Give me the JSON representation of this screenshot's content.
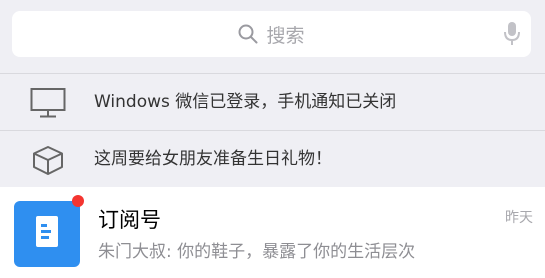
{
  "search": {
    "placeholder_text": "搜索",
    "icon": "search-icon",
    "mic_icon": "microphone-icon"
  },
  "notices": [
    {
      "icon": "monitor-icon",
      "text": "Windows 微信已登录，手机通知已关闭"
    },
    {
      "icon": "box-icon",
      "text": "这周要给女朋友准备生日礼物！"
    }
  ],
  "chat": {
    "title": "订阅号",
    "preview": "朱门大叔: 你的鞋子，暴露了你的生活层次",
    "time": "昨天",
    "avatar_icon": "document-icon",
    "unread": true
  },
  "colors": {
    "accent": "#2f8ff0",
    "badge": "#f43530",
    "background": "#efeff4"
  }
}
